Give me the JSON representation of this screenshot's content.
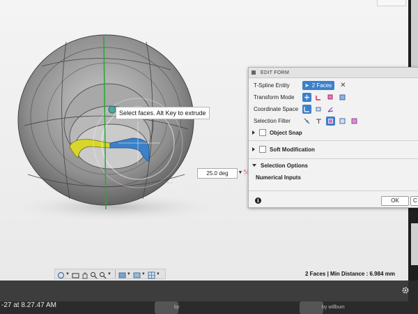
{
  "viewport": {
    "tooltip": "Select faces. Alt Key to extrude",
    "angle_value": "25.0 deg",
    "status": "2 Faces | Min Distance : 6.984 mm"
  },
  "edit_form": {
    "title": "EDIT FORM",
    "tspline_label": "T-Spline Entity",
    "tspline_value": "2 Faces",
    "transform_label": "Transform Mode",
    "coord_label": "Coordinate Space",
    "filter_label": "Selection Filter",
    "object_snap": "Object Snap",
    "soft_mod": "Soft Modification",
    "selection_options": "Selection Options",
    "numerical_inputs": "Numerical Inputs",
    "ok": "OK",
    "cancel_partial": "C"
  },
  "taskbar": {
    "screenshot_stamp": "-27 at 8.27.47 AM",
    "by_1": "by",
    "by_2": "by willbum"
  },
  "colors": {
    "accent_blue": "#3b80c9",
    "model_gray": "#9a9a9a",
    "axis_green": "#22aa33",
    "selection_yellow": "#d9d62a"
  }
}
